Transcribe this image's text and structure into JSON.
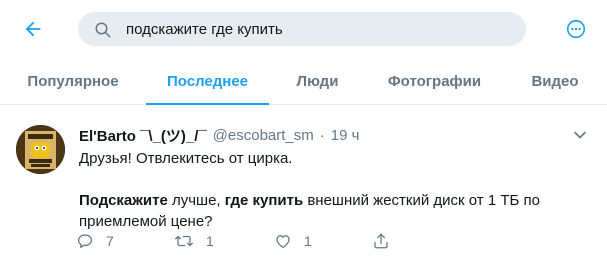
{
  "search": {
    "query": "подскажите где купить"
  },
  "tabs": [
    {
      "label": "Популярное"
    },
    {
      "label": "Последнее"
    },
    {
      "label": "Люди"
    },
    {
      "label": "Фотографии"
    },
    {
      "label": "Видео"
    }
  ],
  "tweet": {
    "name": "El'Barto ¯\\_(ツ)_/¯",
    "handle": "@escobart_sm",
    "separator": "·",
    "time": "19 ч",
    "line1": "Друзья! Отвлекитесь от цирка.",
    "bold1": "Подскажите",
    "text1": " лучше, ",
    "bold2": "где купить",
    "text2": " внешний жесткий диск от 1 ТБ по приемлемой цене?",
    "avatar_text": "WANTED EL BARTO",
    "reply_count": "7",
    "retweet_count": "1",
    "like_count": "1"
  },
  "colors": {
    "accent": "#1da1f2",
    "secondary_text": "#657786",
    "search_bg": "#e6ecf0",
    "divider": "#e6ecf0"
  },
  "icons": [
    "back-arrow-icon",
    "search-icon",
    "more-icon",
    "chevron-down-icon",
    "reply-icon",
    "retweet-icon",
    "like-icon",
    "share-icon"
  ]
}
